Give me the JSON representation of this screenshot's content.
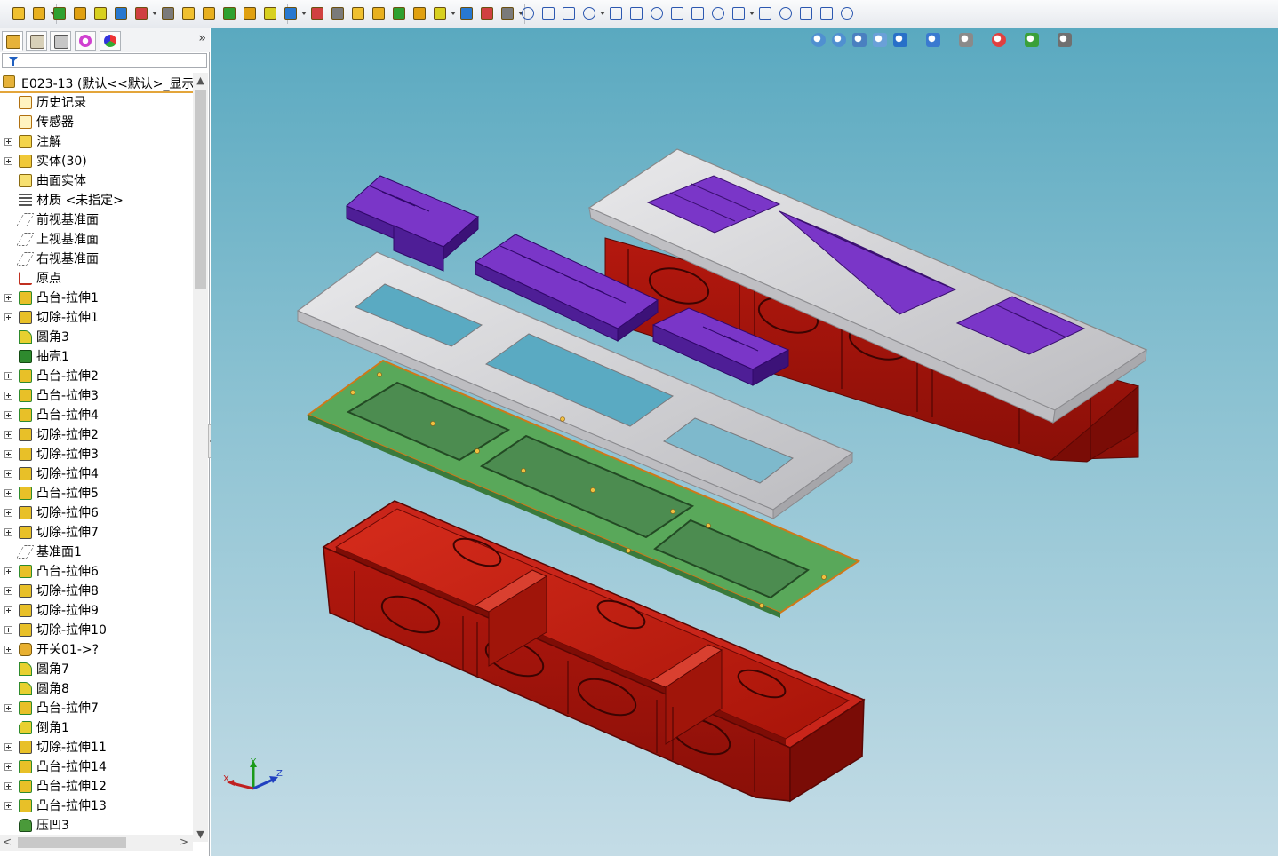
{
  "colors": {
    "accent": "#e3a53a",
    "viewport_top": "#5aa9c0",
    "viewport_bottom": "#c4dce6",
    "body_red": "#c01c10",
    "frame_gray": "#d6d6d8",
    "pcb_green": "#59a85a",
    "module_purple": "#7a36c8"
  },
  "toolbar": {
    "icons": [
      "new-document-icon",
      "save-icon",
      "extruded-boss-icon",
      "revolved-boss-icon",
      "swept-boss-icon",
      "lofted-boss-icon",
      "boundary-boss-icon",
      "extruded-cut-icon",
      "hole-wizard-icon",
      "revolved-cut-icon",
      "swept-cut-icon",
      "lofted-cut-icon",
      "boundary-cut-icon",
      "fillet-icon",
      "linear-pattern-icon",
      "rib-icon",
      "draft-icon",
      "shell-icon",
      "wrap-icon",
      "intersect-icon",
      "mirror-icon",
      "reference-geometry-icon",
      "curves-icon",
      "instant3d-icon",
      "sketch-icon",
      "smart-dimension-icon",
      "line-icon",
      "rectangle-icon",
      "slot-icon",
      "circle-icon",
      "arc-icon",
      "spline-icon",
      "ellipse-icon",
      "fillet-sketch-icon",
      "polygon-icon",
      "point-icon",
      "text-sketch-icon",
      "trim-icon",
      "convert-entities-icon",
      "offset-icon"
    ]
  },
  "feature_manager": {
    "tabs": [
      "feature-manager-tab",
      "property-manager-tab",
      "configuration-manager-tab",
      "dimxpert-tab",
      "display-manager-tab"
    ],
    "more_label": "»",
    "root_label": "E023-13  (默认<<默认>_显示",
    "items": [
      {
        "label": "历史记录",
        "icon": "history-icon",
        "expand": false
      },
      {
        "label": "传感器",
        "icon": "sensors-icon",
        "expand": false
      },
      {
        "label": "注解",
        "icon": "annotations-icon",
        "expand": true
      },
      {
        "label": "实体(30)",
        "icon": "solid-bodies-icon",
        "expand": true
      },
      {
        "label": "曲面实体",
        "icon": "surface-bodies-icon",
        "expand": false
      },
      {
        "label": "材质 <未指定>",
        "icon": "material-icon",
        "expand": false
      },
      {
        "label": "前视基准面",
        "icon": "plane-icon",
        "expand": false
      },
      {
        "label": "上视基准面",
        "icon": "plane-icon",
        "expand": false
      },
      {
        "label": "右视基准面",
        "icon": "plane-icon",
        "expand": false
      },
      {
        "label": "原点",
        "icon": "origin-icon",
        "expand": false
      },
      {
        "label": "凸台-拉伸1",
        "icon": "boss-extrude-icon",
        "expand": true
      },
      {
        "label": "切除-拉伸1",
        "icon": "cut-extrude-icon",
        "expand": true
      },
      {
        "label": "圆角3",
        "icon": "fillet-icon",
        "expand": false
      },
      {
        "label": "抽壳1",
        "icon": "shell-icon",
        "expand": false
      },
      {
        "label": "凸台-拉伸2",
        "icon": "boss-extrude-icon",
        "expand": true
      },
      {
        "label": "凸台-拉伸3",
        "icon": "boss-extrude-icon",
        "expand": true
      },
      {
        "label": "凸台-拉伸4",
        "icon": "boss-extrude-icon",
        "expand": true
      },
      {
        "label": "切除-拉伸2",
        "icon": "cut-extrude-icon",
        "expand": true
      },
      {
        "label": "切除-拉伸3",
        "icon": "cut-extrude-icon",
        "expand": true
      },
      {
        "label": "切除-拉伸4",
        "icon": "cut-extrude-icon",
        "expand": true
      },
      {
        "label": "凸台-拉伸5",
        "icon": "boss-extrude-icon",
        "expand": true
      },
      {
        "label": "切除-拉伸6",
        "icon": "cut-extrude-icon",
        "expand": true
      },
      {
        "label": "切除-拉伸7",
        "icon": "cut-extrude-icon",
        "expand": true
      },
      {
        "label": "基准面1",
        "icon": "plane-icon",
        "expand": false
      },
      {
        "label": "凸台-拉伸6",
        "icon": "boss-extrude-icon",
        "expand": true
      },
      {
        "label": "切除-拉伸8",
        "icon": "cut-extrude-icon",
        "expand": true
      },
      {
        "label": "切除-拉伸9",
        "icon": "cut-extrude-icon",
        "expand": true
      },
      {
        "label": "切除-拉伸10",
        "icon": "cut-extrude-icon",
        "expand": true
      },
      {
        "label": "开关01->?",
        "icon": "derived-part-icon",
        "expand": true
      },
      {
        "label": "圆角7",
        "icon": "fillet-icon",
        "expand": false
      },
      {
        "label": "圆角8",
        "icon": "fillet-icon",
        "expand": false
      },
      {
        "label": "凸台-拉伸7",
        "icon": "boss-extrude-icon",
        "expand": true
      },
      {
        "label": "倒角1",
        "icon": "chamfer-icon",
        "expand": false
      },
      {
        "label": "切除-拉伸11",
        "icon": "cut-extrude-icon",
        "expand": true
      },
      {
        "label": "凸台-拉伸14",
        "icon": "boss-extrude-icon",
        "expand": true
      },
      {
        "label": "凸台-拉伸12",
        "icon": "boss-extrude-icon",
        "expand": true
      },
      {
        "label": "凸台-拉伸13",
        "icon": "boss-extrude-icon",
        "expand": true
      },
      {
        "label": "压凹3",
        "icon": "indent-icon",
        "expand": false
      }
    ]
  },
  "heads_up": {
    "icons": [
      "zoom-to-fit-icon",
      "zoom-to-area-icon",
      "previous-view-icon",
      "section-view-icon",
      "view-orientation-icon",
      "display-style-icon",
      "hide-show-items-icon",
      "edit-appearance-icon",
      "apply-scene-icon",
      "view-settings-icon"
    ]
  },
  "triad": {
    "x_label": "X",
    "y_label": "Y",
    "z_label": "Z"
  }
}
